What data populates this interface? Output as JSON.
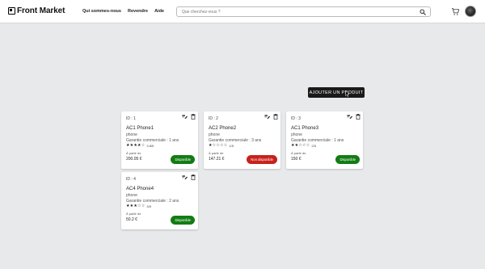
{
  "header": {
    "logo_text": "Front Market",
    "nav": [
      "Qui sommes-nous",
      "Revendre",
      "Aide"
    ],
    "search_placeholder": "Que cherchez-vous ?",
    "icons": {
      "logo": "logo-icon",
      "search": "search-icon",
      "cart": "cart-icon",
      "avatar": "avatar"
    }
  },
  "main": {
    "add_button": "Ajouter un produit",
    "products": [
      {
        "id": "ID : 1",
        "name": "AC1 Phone1",
        "category": "phone",
        "garantie": "Garantie commerciale : 1 ans",
        "rating": 4,
        "rating_text": "3.8/5",
        "price_label": "À partir de",
        "price": "200.05 €",
        "status": "Disponible",
        "status_color": "#127c14"
      },
      {
        "id": "ID : 2",
        "name": "AC2 Phone2",
        "category": "phone",
        "garantie": "Garantie commerciale : 3 ans",
        "rating": 1,
        "rating_text": "1/5",
        "price_label": "À partir de",
        "price": "147.21 €",
        "status": "Non disponible",
        "status_color": "#c7221c"
      },
      {
        "id": "ID : 3",
        "name": "AC1 Phone3",
        "category": "phone",
        "garantie": "Garantie commerciale : 1 ans",
        "rating": 2,
        "rating_text": "2/5",
        "price_label": "À partir de",
        "price": "150 €",
        "status": "Disponible",
        "status_color": "#127c14"
      },
      {
        "id": "ID : 4",
        "name": "AC4 Phone4",
        "category": "phone",
        "garantie": "Garantie commerciale : 2 ans",
        "rating": 3,
        "rating_text": "3/5",
        "price_label": "À partir de",
        "price": "50.2 €",
        "status": "Disponible",
        "status_color": "#127c14"
      }
    ]
  }
}
